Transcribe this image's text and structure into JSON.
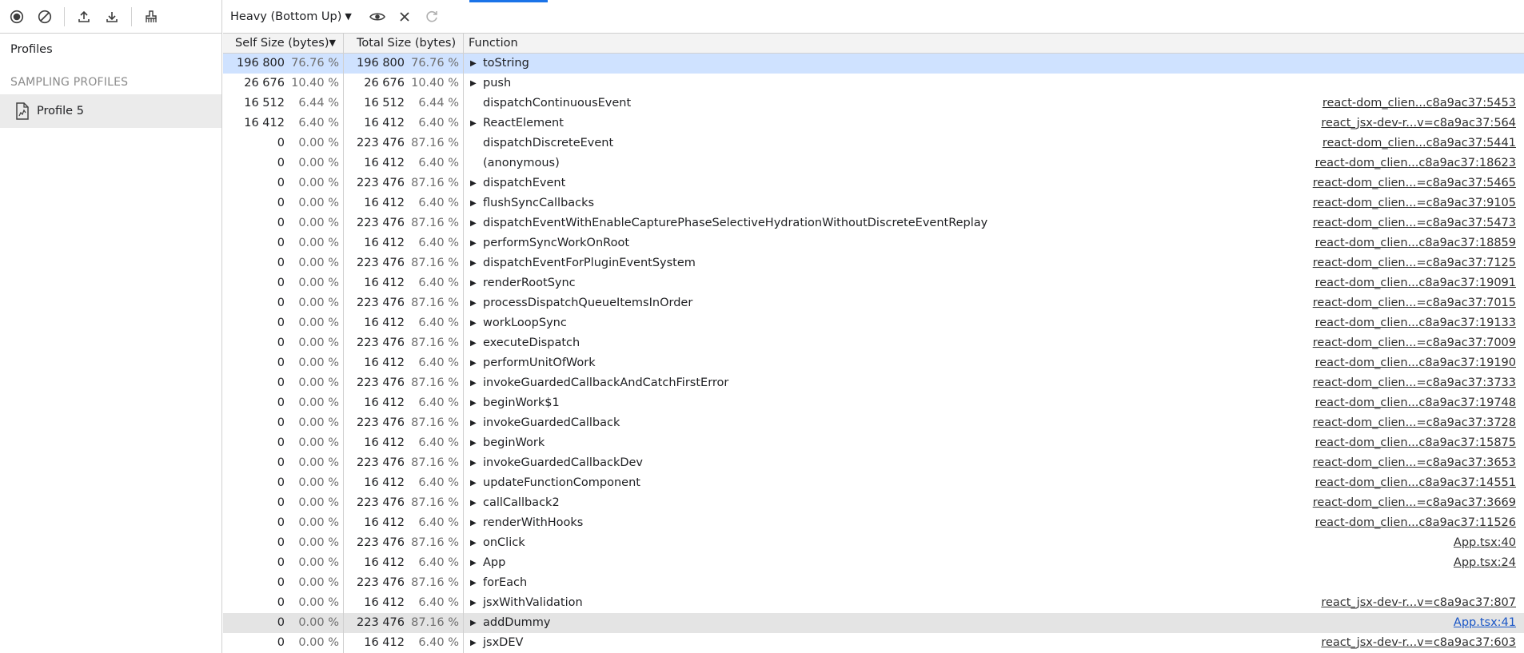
{
  "left_panel": {
    "profiles_label": "Profiles",
    "section_label": "SAMPLING PROFILES",
    "profile_item_label": "Profile 5",
    "toolbar_icons": [
      "record-icon",
      "clear-icon",
      "upload-icon",
      "download-icon",
      "garbage-collect-icon"
    ]
  },
  "toolbar": {
    "view_label": "Heavy (Bottom Up)",
    "icons": [
      "eye-icon",
      "close-icon",
      "reload-icon"
    ]
  },
  "columns": {
    "self": "Self Size (bytes)",
    "total": "Total Size (bytes)",
    "function": "Function"
  },
  "colors": {
    "selected_row": "#cfe2ff",
    "hovered_row": "#e4e4e4",
    "link_blue": "#1a56c6"
  },
  "rows": [
    {
      "self": "196 800",
      "self_pct": "76.76 %",
      "total": "196 800",
      "total_pct": "76.76 %",
      "expand": true,
      "name": "toString",
      "url": "",
      "state": "selected"
    },
    {
      "self": "26 676",
      "self_pct": "10.40 %",
      "total": "26 676",
      "total_pct": "10.40 %",
      "expand": true,
      "name": "push",
      "url": ""
    },
    {
      "self": "16 512",
      "self_pct": "6.44 %",
      "total": "16 512",
      "total_pct": "6.44 %",
      "expand": false,
      "name": "dispatchContinuousEvent",
      "url": "react-dom_clien...c8a9ac37:5453"
    },
    {
      "self": "16 412",
      "self_pct": "6.40 %",
      "total": "16 412",
      "total_pct": "6.40 %",
      "expand": true,
      "name": "ReactElement",
      "url": "react_jsx-dev-r...v=c8a9ac37:564"
    },
    {
      "self": "0",
      "self_pct": "0.00 %",
      "total": "223 476",
      "total_pct": "87.16 %",
      "expand": false,
      "name": "dispatchDiscreteEvent",
      "url": "react-dom_clien...c8a9ac37:5441"
    },
    {
      "self": "0",
      "self_pct": "0.00 %",
      "total": "16 412",
      "total_pct": "6.40 %",
      "expand": false,
      "name": "(anonymous)",
      "url": "react-dom_clien...c8a9ac37:18623"
    },
    {
      "self": "0",
      "self_pct": "0.00 %",
      "total": "223 476",
      "total_pct": "87.16 %",
      "expand": true,
      "name": "dispatchEvent",
      "url": "react-dom_clien...=c8a9ac37:5465"
    },
    {
      "self": "0",
      "self_pct": "0.00 %",
      "total": "16 412",
      "total_pct": "6.40 %",
      "expand": true,
      "name": "flushSyncCallbacks",
      "url": "react-dom_clien...=c8a9ac37:9105"
    },
    {
      "self": "0",
      "self_pct": "0.00 %",
      "total": "223 476",
      "total_pct": "87.16 %",
      "expand": true,
      "name": "dispatchEventWithEnableCapturePhaseSelectiveHydrationWithoutDiscreteEventReplay",
      "url": "react-dom_clien...=c8a9ac37:5473"
    },
    {
      "self": "0",
      "self_pct": "0.00 %",
      "total": "16 412",
      "total_pct": "6.40 %",
      "expand": true,
      "name": "performSyncWorkOnRoot",
      "url": "react-dom_clien...c8a9ac37:18859"
    },
    {
      "self": "0",
      "self_pct": "0.00 %",
      "total": "223 476",
      "total_pct": "87.16 %",
      "expand": true,
      "name": "dispatchEventForPluginEventSystem",
      "url": "react-dom_clien...=c8a9ac37:7125"
    },
    {
      "self": "0",
      "self_pct": "0.00 %",
      "total": "16 412",
      "total_pct": "6.40 %",
      "expand": true,
      "name": "renderRootSync",
      "url": "react-dom_clien...c8a9ac37:19091"
    },
    {
      "self": "0",
      "self_pct": "0.00 %",
      "total": "223 476",
      "total_pct": "87.16 %",
      "expand": true,
      "name": "processDispatchQueueItemsInOrder",
      "url": "react-dom_clien...=c8a9ac37:7015"
    },
    {
      "self": "0",
      "self_pct": "0.00 %",
      "total": "16 412",
      "total_pct": "6.40 %",
      "expand": true,
      "name": "workLoopSync",
      "url": "react-dom_clien...c8a9ac37:19133"
    },
    {
      "self": "0",
      "self_pct": "0.00 %",
      "total": "223 476",
      "total_pct": "87.16 %",
      "expand": true,
      "name": "executeDispatch",
      "url": "react-dom_clien...=c8a9ac37:7009"
    },
    {
      "self": "0",
      "self_pct": "0.00 %",
      "total": "16 412",
      "total_pct": "6.40 %",
      "expand": true,
      "name": "performUnitOfWork",
      "url": "react-dom_clien...c8a9ac37:19190"
    },
    {
      "self": "0",
      "self_pct": "0.00 %",
      "total": "223 476",
      "total_pct": "87.16 %",
      "expand": true,
      "name": "invokeGuardedCallbackAndCatchFirstError",
      "url": "react-dom_clien...=c8a9ac37:3733"
    },
    {
      "self": "0",
      "self_pct": "0.00 %",
      "total": "16 412",
      "total_pct": "6.40 %",
      "expand": true,
      "name": "beginWork$1",
      "url": "react-dom_clien...c8a9ac37:19748"
    },
    {
      "self": "0",
      "self_pct": "0.00 %",
      "total": "223 476",
      "total_pct": "87.16 %",
      "expand": true,
      "name": "invokeGuardedCallback",
      "url": "react-dom_clien...=c8a9ac37:3728"
    },
    {
      "self": "0",
      "self_pct": "0.00 %",
      "total": "16 412",
      "total_pct": "6.40 %",
      "expand": true,
      "name": "beginWork",
      "url": "react-dom_clien...c8a9ac37:15875"
    },
    {
      "self": "0",
      "self_pct": "0.00 %",
      "total": "223 476",
      "total_pct": "87.16 %",
      "expand": true,
      "name": "invokeGuardedCallbackDev",
      "url": "react-dom_clien...=c8a9ac37:3653"
    },
    {
      "self": "0",
      "self_pct": "0.00 %",
      "total": "16 412",
      "total_pct": "6.40 %",
      "expand": true,
      "name": "updateFunctionComponent",
      "url": "react-dom_clien...c8a9ac37:14551"
    },
    {
      "self": "0",
      "self_pct": "0.00 %",
      "total": "223 476",
      "total_pct": "87.16 %",
      "expand": true,
      "name": "callCallback2",
      "url": "react-dom_clien...=c8a9ac37:3669"
    },
    {
      "self": "0",
      "self_pct": "0.00 %",
      "total": "16 412",
      "total_pct": "6.40 %",
      "expand": true,
      "name": "renderWithHooks",
      "url": "react-dom_clien...c8a9ac37:11526"
    },
    {
      "self": "0",
      "self_pct": "0.00 %",
      "total": "223 476",
      "total_pct": "87.16 %",
      "expand": true,
      "name": "onClick",
      "url": "App.tsx:40"
    },
    {
      "self": "0",
      "self_pct": "0.00 %",
      "total": "16 412",
      "total_pct": "6.40 %",
      "expand": true,
      "name": "App",
      "url": "App.tsx:24"
    },
    {
      "self": "0",
      "self_pct": "0.00 %",
      "total": "223 476",
      "total_pct": "87.16 %",
      "expand": true,
      "name": "forEach",
      "url": ""
    },
    {
      "self": "0",
      "self_pct": "0.00 %",
      "total": "16 412",
      "total_pct": "6.40 %",
      "expand": true,
      "name": "jsxWithValidation",
      "url": "react_jsx-dev-r...v=c8a9ac37:807"
    },
    {
      "self": "0",
      "self_pct": "0.00 %",
      "total": "223 476",
      "total_pct": "87.16 %",
      "expand": true,
      "name": "addDummy",
      "url": "App.tsx:41",
      "state": "hovered"
    },
    {
      "self": "0",
      "self_pct": "0.00 %",
      "total": "16 412",
      "total_pct": "6.40 %",
      "expand": true,
      "name": "jsxDEV",
      "url": "react_jsx-dev-r...v=c8a9ac37:603"
    }
  ]
}
